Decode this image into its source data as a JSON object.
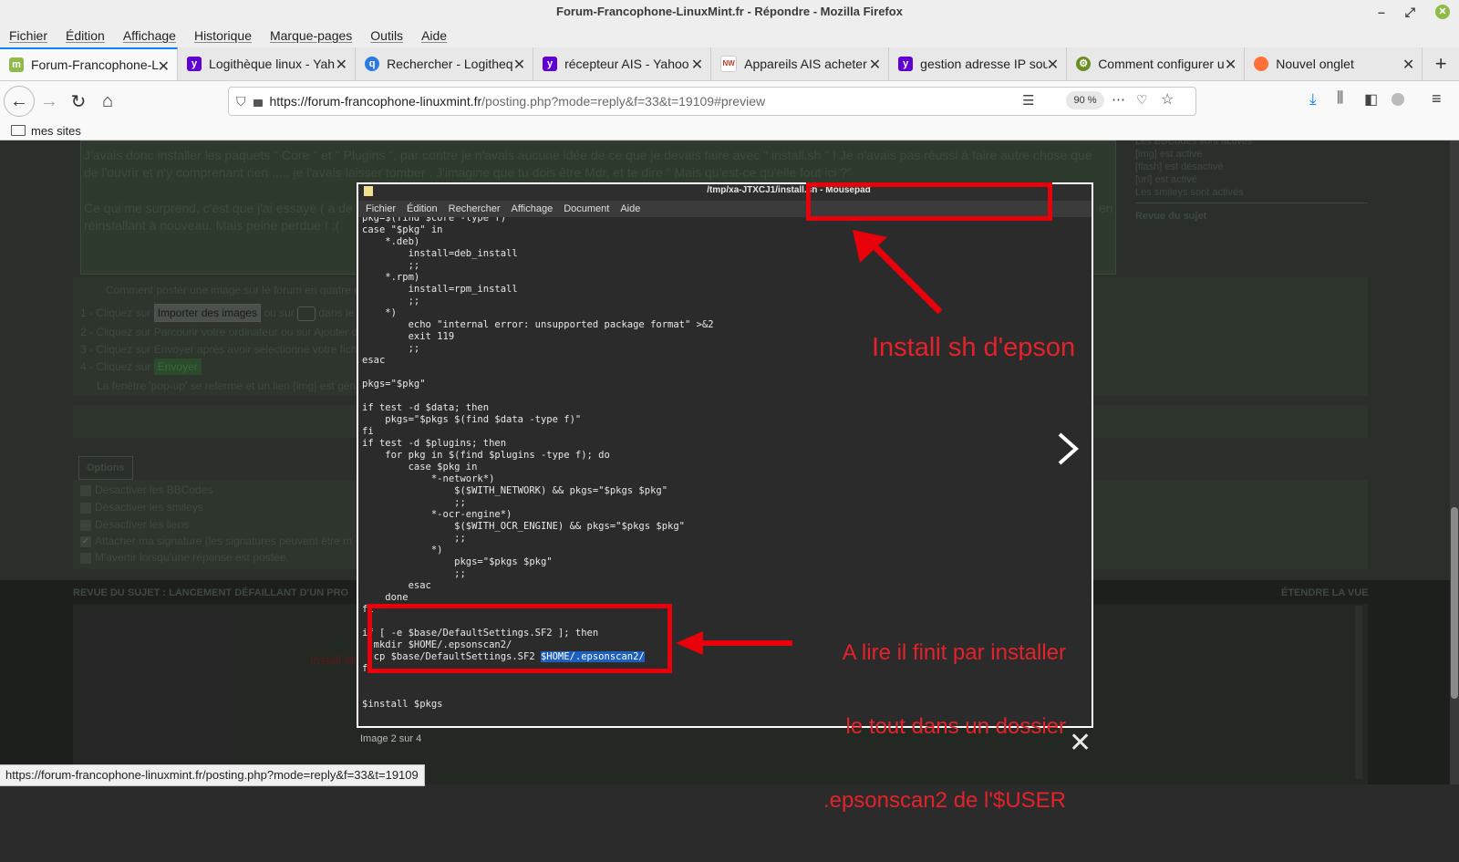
{
  "window": {
    "title": "Forum-Francophone-LinuxMint.fr - Répondre - Mozilla Firefox"
  },
  "menu": [
    "Fichier",
    "Édition",
    "Affichage",
    "Historique",
    "Marque-pages",
    "Outils",
    "Aide"
  ],
  "tabs": [
    {
      "label": "Forum-Francophone-Li",
      "icon": "linuxmint-icon",
      "color": "#8fba4a"
    },
    {
      "label": "Logithèque linux - Yah",
      "icon": "yahoo-icon",
      "color": "#6001d2"
    },
    {
      "label": "Rechercher - Logitheq",
      "icon": "search-icon",
      "color": "#2a7ae2"
    },
    {
      "label": "récepteur AIS - Yahoo",
      "icon": "yahoo-icon",
      "color": "#6001d2"
    },
    {
      "label": "Appareils AIS acheter",
      "icon": "shop-icon",
      "color": "#c0392b"
    },
    {
      "label": "gestion adresse IP sou",
      "icon": "yahoo-icon",
      "color": "#6001d2"
    },
    {
      "label": "Comment configurer u",
      "icon": "gear-icon",
      "color": "#6b8e23"
    },
    {
      "label": "Nouvel onglet",
      "icon": "firefox-icon",
      "color": "#ff7139"
    }
  ],
  "address": {
    "host": "https://forum-francophone-linuxmint.fr",
    "path": "/posting.php?mode=reply&f=33&t=19109#preview",
    "zoom": "90 %"
  },
  "bookmarks": {
    "folder": "mes sites"
  },
  "page": {
    "post_line1": "J'avais donc installer les paquets \" Core \" et \" Plugins \", par contre je n'avais aucune idée de ce que je devais faire avec \" install.sh \" ! Je n'avais pas réussi à faire autre chose que",
    "post_line2": "de l'ouvrir et n'y comprenant rien ..... je l'avais laisser tomber . J'imagine que tu dois être Mdr, et te dire \" Mais qu'est-ce qu'elle fout ici ?\"",
    "post_line3": "Ce qui me surprend, c'est que j'ai essayé ( à de",
    "post_line3b": "en",
    "post_line4": "réinstallant à nouveau. Mais peine perdue ! :(",
    "howto": "Comment poster une image sur le forum en quatre é",
    "steps": [
      "1 - Cliquez sur",
      "2 - Cliquez sur Parcourir votre ordinateur ou sur Ajouter d",
      "3 - Cliquez sur Envoyer après avoir sélectionné votre fich",
      "4 - Cliquez sur"
    ],
    "import_btn": "Importer des images",
    "or_on": "ou sur",
    "in_the": "dans le",
    "send_btn": "Envoyer",
    "popup_note": "La fenêtre 'pop-up' se referme et un lien [img] est gén",
    "sidebar": [
      "Les BBCodes sont activés",
      "[img] est activé",
      "[flash] est désactivé",
      "[url] est activé",
      "Les smileys sont activés"
    ],
    "revue_link": "Revue du sujet",
    "options_tab": "Options",
    "options": [
      "Désactiver les BBCodes",
      "Désactiver les smileys",
      "Désactiver les liens",
      "Attacher ma signature (les signatures peuvent être m",
      "M'avertir lorsqu'une réponse est postée."
    ],
    "options_checked": [
      false,
      false,
      false,
      true,
      false
    ],
    "revue_header": "REVUE DU SUJET : LANCEMENT DÉFAILLANT D'UN PRO",
    "expand_view": "ÉTENDRE LA VUE",
    "thumb_text": "Install sh"
  },
  "lightbox": {
    "window_title": "/tmp/xa-JTXCJ1/install.sh - Mousepad",
    "editor_menu": [
      "Fichier",
      "Édition",
      "Rechercher",
      "Affichage",
      "Document",
      "Aide"
    ],
    "code_lines": [
      "pkg=$(find $core -type f)",
      "case \"$pkg\" in",
      "    *.deb)",
      "        install=deb_install",
      "        ;;",
      "    *.rpm)",
      "        install=rpm_install",
      "        ;;",
      "    *)",
      "        echo \"internal error: unsupported package format\" >&2",
      "        exit 119",
      "        ;;",
      "esac",
      "",
      "pkgs=\"$pkg\"",
      "",
      "if test -d $data; then",
      "    pkgs=\"$pkgs $(find $data -type f)\"",
      "fi",
      "if test -d $plugins; then",
      "    for pkg in $(find $plugins -type f); do",
      "        case $pkg in",
      "            *-network*)",
      "                $($WITH_NETWORK) && pkgs=\"$pkgs $pkg\"",
      "                ;;",
      "            *-ocr-engine*)",
      "                $($WITH_OCR_ENGINE) && pkgs=\"$pkgs $pkg\"",
      "                ;;",
      "            *)",
      "                pkgs=\"$pkgs $pkg\"",
      "                ;;",
      "        esac",
      "    done",
      "fi",
      "",
      "if [ -e $base/DefaultSettings.SF2 ]; then",
      "  mkdir $HOME/.epsonscan2/",
      "  cp $base/DefaultSettings.SF2 "
    ],
    "code_highlight": "$HOME/.epsonscan2/",
    "code_after": [
      "fi",
      "",
      "",
      "$install $pkgs"
    ],
    "annotation1": "Install sh d'epson",
    "annotation2": [
      "A lire il finit par installer",
      "le tout dans un dossier",
      ".epsonscan2 de l'$USER"
    ],
    "caption": "Image 2 sur 4",
    "annotation_color": "#e5222a"
  },
  "status_url": "https://forum-francophone-linuxmint.fr/posting.php?mode=reply&f=33&t=19109"
}
